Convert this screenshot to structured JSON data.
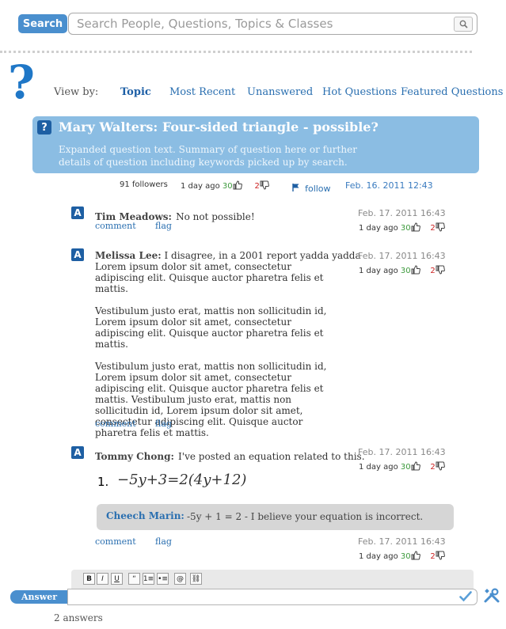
{
  "search": {
    "label": "Search",
    "placeholder": "Search People, Questions, Topics & Classes"
  },
  "viewby": {
    "label": "View by:",
    "tabs": [
      "Topic",
      "Most Recent",
      "Unanswered",
      "Hot Questions",
      "Featured Questions"
    ],
    "active": "Topic"
  },
  "question": {
    "icon": "?",
    "title": "Mary Walters: Four-sided triangle - possible?",
    "summary": "Expanded question text. Summary of question here or further details of question including keywords picked up by search.",
    "followers": "91 followers",
    "age": "1 day ago",
    "up": "30",
    "down": "2",
    "follow_label": "follow",
    "date": "Feb. 16. 2011 12:43"
  },
  "answers": [
    {
      "author": "Tim Meadows:",
      "text": "No not possible!",
      "date": "Feb. 17. 2011 16:43",
      "age": "1 day ago",
      "up": "30",
      "down": "2",
      "comment_label": "comment",
      "flag_label": "flag"
    },
    {
      "author": "Melissa Lee:",
      "first_line": "I disagree, in a 2001 report yadda yadda",
      "paragraphs": [
        "Lorem ipsum dolor sit amet, consectetur adipiscing elit. Quisque auctor pharetra felis et mattis.",
        "Vestibulum justo erat, mattis non sollicitudin id, Lorem ipsum dolor sit amet, consectetur adipiscing elit. Quisque auctor pharetra felis et mattis.",
        "Vestibulum justo erat, mattis non sollicitudin id, Lorem ipsum dolor sit amet, consectetur adipiscing elit. Quisque auctor pharetra felis et mattis. Vestibulum justo erat, mattis non sollicitudin id, Lorem ipsum dolor sit amet, consectetur adipiscing elit. Quisque auctor pharetra felis et mattis."
      ],
      "date": "Feb. 17. 2011 16:43",
      "age": "1 day ago",
      "up": "30",
      "down": "2",
      "comment_label": "comment",
      "flag_label": "flag"
    },
    {
      "author": "Tommy Chong:",
      "text": "I've posted an equation related to this.",
      "equation_number": "1.",
      "equation": "−5y+3=2(4y+12)",
      "date": "Feb. 17. 2011 16:43",
      "age": "1 day ago",
      "up": "30",
      "down": "2",
      "comment": {
        "author": "Cheech Marin:",
        "text": "-5y + 1 = 2 - I believe your equation is incorrect.",
        "date": "Feb. 17. 2011 16:43",
        "age": "1 day ago",
        "up": "30",
        "down": "2"
      },
      "comment_label": "comment",
      "flag_label": "flag"
    }
  ],
  "editor": {
    "buttons": [
      "B",
      "I",
      "U",
      "“",
      "1≡",
      "•≡",
      "@",
      "⛓"
    ],
    "answer_label": "Answer"
  },
  "answer_count": "2 answers",
  "colors": {
    "accent": "#4a8fce",
    "question_box": "#8bbde3",
    "icon_bg": "#1e5fa3",
    "upvote": "#3d9a3d",
    "downvote": "#cc2222"
  }
}
